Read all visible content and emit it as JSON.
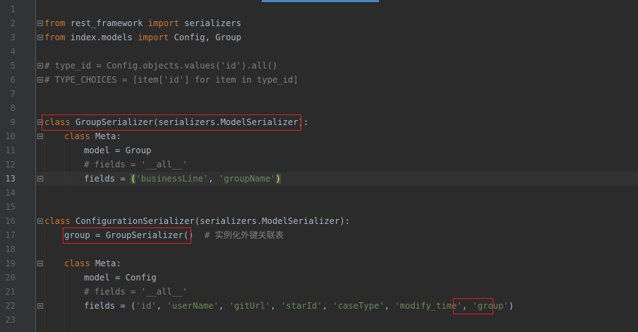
{
  "editor": {
    "line_numbers": [
      "1",
      "2",
      "3",
      "4",
      "5",
      "6",
      "7",
      "8",
      "9",
      "10",
      "11",
      "12",
      "13",
      "14",
      "15",
      "16",
      "17",
      "18",
      "19",
      "20",
      "21",
      "22",
      "23"
    ],
    "current_line": "13",
    "lines": {
      "l2": {
        "kw1": "from",
        "t1": " rest_framework ",
        "kw2": "import",
        "t2": " serializers"
      },
      "l3": {
        "kw1": "from",
        "t1": " index.models ",
        "kw2": "import",
        "t2": " Config, Group"
      },
      "l5": {
        "c": "# type_id = Config.objects.values('id').all()"
      },
      "l6": {
        "c": "# TYPE_CHOICES = [item['id'] for item in type_id]"
      },
      "l9": {
        "kw": "class",
        "t": " GroupSerializer(serializers.ModelSerializer):"
      },
      "l10": {
        "kw": "class",
        "t": " Meta:"
      },
      "l11": {
        "t": "model = Group"
      },
      "l12": {
        "c": "# fields = '__all__'"
      },
      "l13": {
        "t1": "fields = ",
        "p1": "(",
        "s1": "'businessLine'",
        "t2": ", ",
        "s2": "'groupName'",
        "p2": ")"
      },
      "l16": {
        "kw": "class",
        "t": " ConfigurationSerializer(serializers.ModelSerializer):"
      },
      "l17": {
        "t": "group = GroupSerializer()",
        "c": " # 实例化外键关联表"
      },
      "l19": {
        "kw": "class",
        "t": " Meta:"
      },
      "l20": {
        "t": "model = Config"
      },
      "l21": {
        "c": "# fields = '__all__'"
      },
      "l22": {
        "t1": "fields = (",
        "s1": "'id'",
        "sep1": ", ",
        "s2": "'userName'",
        "sep2": ", ",
        "s3": "'gitUrl'",
        "sep3": ", ",
        "s4": "'starId'",
        "sep4": ", ",
        "s5": "'caseType'",
        "sep5": ", ",
        "s6": "'modify_time'",
        "sep6": ", ",
        "s7": "'group'",
        "t2": ")"
      }
    }
  },
  "colors": {
    "background": "#2b2b2b",
    "keyword": "#cc7832",
    "string": "#6a8759",
    "comment": "#808080",
    "text": "#a9b7c6",
    "annotation_box": "#e0201f"
  }
}
